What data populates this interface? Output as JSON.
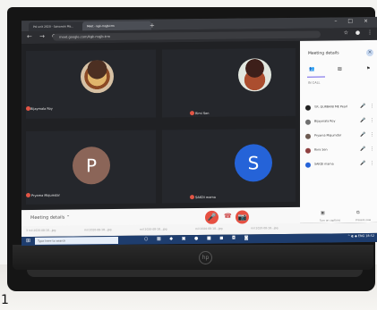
{
  "edge_mark": "1",
  "browser": {
    "tabs": [
      "Poi unit 2020 - Saisanchi Ma...",
      "Meet - kgk-mqjb-trm"
    ],
    "new_tab": "+",
    "window_controls": "–  □  ×",
    "url": "meet.google.com/kgk-mqjb-trm",
    "nav": "←  →  ⟳",
    "actions": "☆  ●  ⋮"
  },
  "participants": [
    {
      "name": "Bijaymala Roy",
      "avatar": ""
    },
    {
      "name": "Rimi Sen",
      "avatar": ""
    },
    {
      "name": "Pryama Majumdar",
      "avatar": "P"
    },
    {
      "name": "SAKDI mama",
      "avatar": "S"
    }
  ],
  "details": {
    "title": "Meeting details",
    "close": "×",
    "tabs": [
      "👥",
      "▤",
      "⚑"
    ],
    "section": "IN CALL",
    "people": [
      {
        "name": "Y.R. GURBANI ME Pearl",
        "color": "#222222"
      },
      {
        "name": "Bijaymala Roy",
        "color": "#6f6f6f"
      },
      {
        "name": "Pryama Majumdar",
        "color": "#6c5a51"
      },
      {
        "name": "Rimi Sen",
        "color": "#8f4040"
      },
      {
        "name": "SAKDI mama",
        "color": "#2563d8"
      }
    ]
  },
  "bottom": {
    "meeting_label": "Meeting details ⌃",
    "mic": "🎤",
    "center": "☎",
    "camera": "📷",
    "captions": "▣",
    "captions_label": "Turn on captions",
    "present": "⧉",
    "present_label": "Present now"
  },
  "downloads": [
    "3 mil 2020-08-18...jpg",
    "mil 2020-08-18...jpg",
    "mil 2020-08-18...jpg",
    "mil 2020-08-18...jpg",
    "mil 2020-08-18...jpg"
  ],
  "taskbar": {
    "start": "⊞",
    "search": "Type here to search",
    "icons": "○ ▦ ◆ ▣ ● ■ ◼ ◘ ◙",
    "tray": "^  ◐  ◆  ENG  18:52"
  },
  "laptop": {
    "logo": "hp"
  }
}
